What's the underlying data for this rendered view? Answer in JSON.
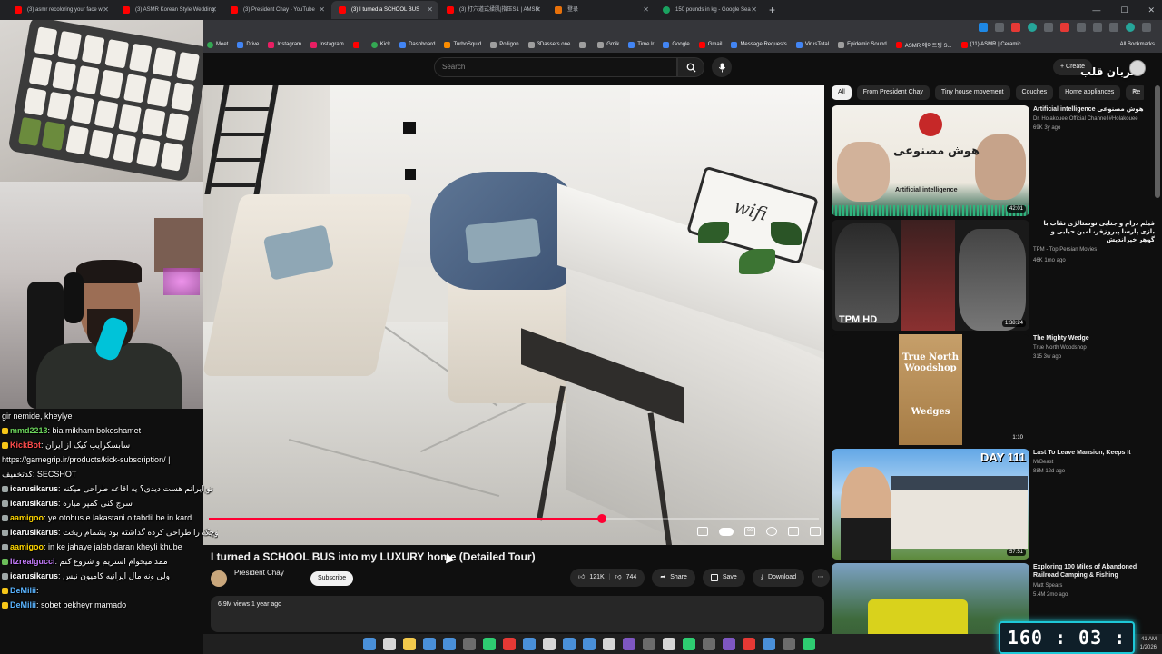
{
  "browser": {
    "tabs": [
      {
        "label": "(3) asmr recoloring your face w",
        "active": false
      },
      {
        "label": "(3) ASMR Korean Style Wedding",
        "active": false
      },
      {
        "label": "(3) President Chay - YouTube",
        "active": false
      },
      {
        "label": "(3) I turned a SCHOOL BUS",
        "active": true
      },
      {
        "label": "(3) 打穴道式揉肌|指压S1 | AMSR",
        "active": false
      },
      {
        "label": "登录",
        "active": false
      },
      {
        "label": "150 pounds in kg - Google Sea",
        "active": false
      }
    ],
    "new_tab": "+",
    "bookmarks": [
      "Meet",
      "Drive",
      "Instagram",
      "Instagram",
      "",
      "Kick",
      "Dashboard",
      "TurboSquid",
      "Polligon",
      "3Dassets.one",
      "",
      "Gmik",
      "Time.lr",
      "Google",
      "Gmail",
      "Message Requests",
      "VirusTotal",
      "Epidemic Sound",
      "ASMR 에이트팅 S...",
      "(11) ASMR | Ceramic..."
    ],
    "all_bookmarks": "All Bookmarks"
  },
  "youtube": {
    "search_placeholder": "Search",
    "create_label": "Create",
    "channel_overlay": "صربان قلب",
    "video": {
      "title": "I turned a SCHOOL BUS into my LUXURY home (Detailed Tour)",
      "channel": "President Chay",
      "subs": "",
      "subscribe": "Subscribe",
      "meta": "6.9M views  1 year ago",
      "likes": "121K",
      "dislikes": "744",
      "share": "Share",
      "save": "Save",
      "download": "Download",
      "more": "⋯",
      "progress": 0.645,
      "sign_text": "wifi"
    },
    "chips": [
      {
        "label": "All",
        "active": true
      },
      {
        "label": "From President Chay",
        "active": false
      },
      {
        "label": "Tiny house movement",
        "active": false
      },
      {
        "label": "Couches",
        "active": false
      },
      {
        "label": "Home appliances",
        "active": false
      },
      {
        "label": "Re",
        "active": false
      }
    ],
    "recommendations": [
      {
        "title": "Artificial intelligence هوش مصنوعی",
        "channel": "Dr. Holakouee Official Channel #Holakouee",
        "meta": "69K  3y ago",
        "duration": "42:01",
        "thumb_text": "هوش مصنوعی",
        "thumb_sub": "Artificial intelligence"
      },
      {
        "title": "فیلم درام و جنایی نوستالژی نقاب با بازی پارسا پیروزفر، امین حیایی و گوهر خیراندیش",
        "channel": "TPM - Top Persian Movies",
        "meta": "46K  1mo ago",
        "duration": "1:38:24",
        "thumb_text": "TPM HD"
      },
      {
        "title": "The Mighty Wedge",
        "channel": "True North Woodshop",
        "meta": "315  3w ago",
        "duration": "1:10",
        "thumb_text": "True North Woodshop",
        "thumb_sub": "Wedges"
      },
      {
        "title": "Last To Leave Mansion, Keeps It",
        "channel": "MrBeast",
        "meta": "88M  12d ago",
        "duration": "57:51",
        "thumb_text": "DAY 111"
      },
      {
        "title": "Exploring 100 Miles of Abandoned Railroad Camping & Fishing",
        "channel": "Matt Spears",
        "meta": "5.4M  2mo ago",
        "duration": ""
      }
    ]
  },
  "chat": [
    {
      "user": "",
      "text": "gir nemide, kheylye"
    },
    {
      "user": "mmd2213",
      "text": "bia mikham bokoshamet"
    },
    {
      "user": "KickBot",
      "text": "سابسکرایب کیک از ایران"
    },
    {
      "user": "",
      "text": "https://gamegrip.ir/products/kick-subscription/ |"
    },
    {
      "user": "",
      "text": "کدتخفیف: SECSHOT"
    },
    {
      "user": "icarusikarus",
      "text": "تو ایرانم هست دیدی؟ یه اقاعه طراحی میکنه"
    },
    {
      "user": "icarusikarus",
      "text": "سرچ کنی کمپر میاره"
    },
    {
      "user": "aamigoo",
      "text": "ye otobus e lakastani o tabdil be in kard"
    },
    {
      "user": "icarusikarus",
      "text": "خانه کوچک را طراحی کرده گذاشته بود پشمام ریخت"
    },
    {
      "user": "aamigoo",
      "text": "in ke jahaye jaleb daran kheyli khube"
    },
    {
      "user": "Itzrealgucci",
      "text": "ممد میخوام استریم و شروع کنم"
    },
    {
      "user": "icarusikarus",
      "text": "ولی ونه مال ایرانیه کامیون نیس"
    },
    {
      "user": "DeMilii",
      "text": ""
    },
    {
      "user": "DeMilii",
      "text": "sobet bekheyr mamado"
    }
  ],
  "taskbar": {
    "time": "41 AM",
    "date": "1/2026"
  },
  "timer": "160 : 03 : 57",
  "colors": {
    "progress": "#ff0033",
    "timer_border": "#1ec8d8",
    "bg": "#0f0f0f"
  }
}
